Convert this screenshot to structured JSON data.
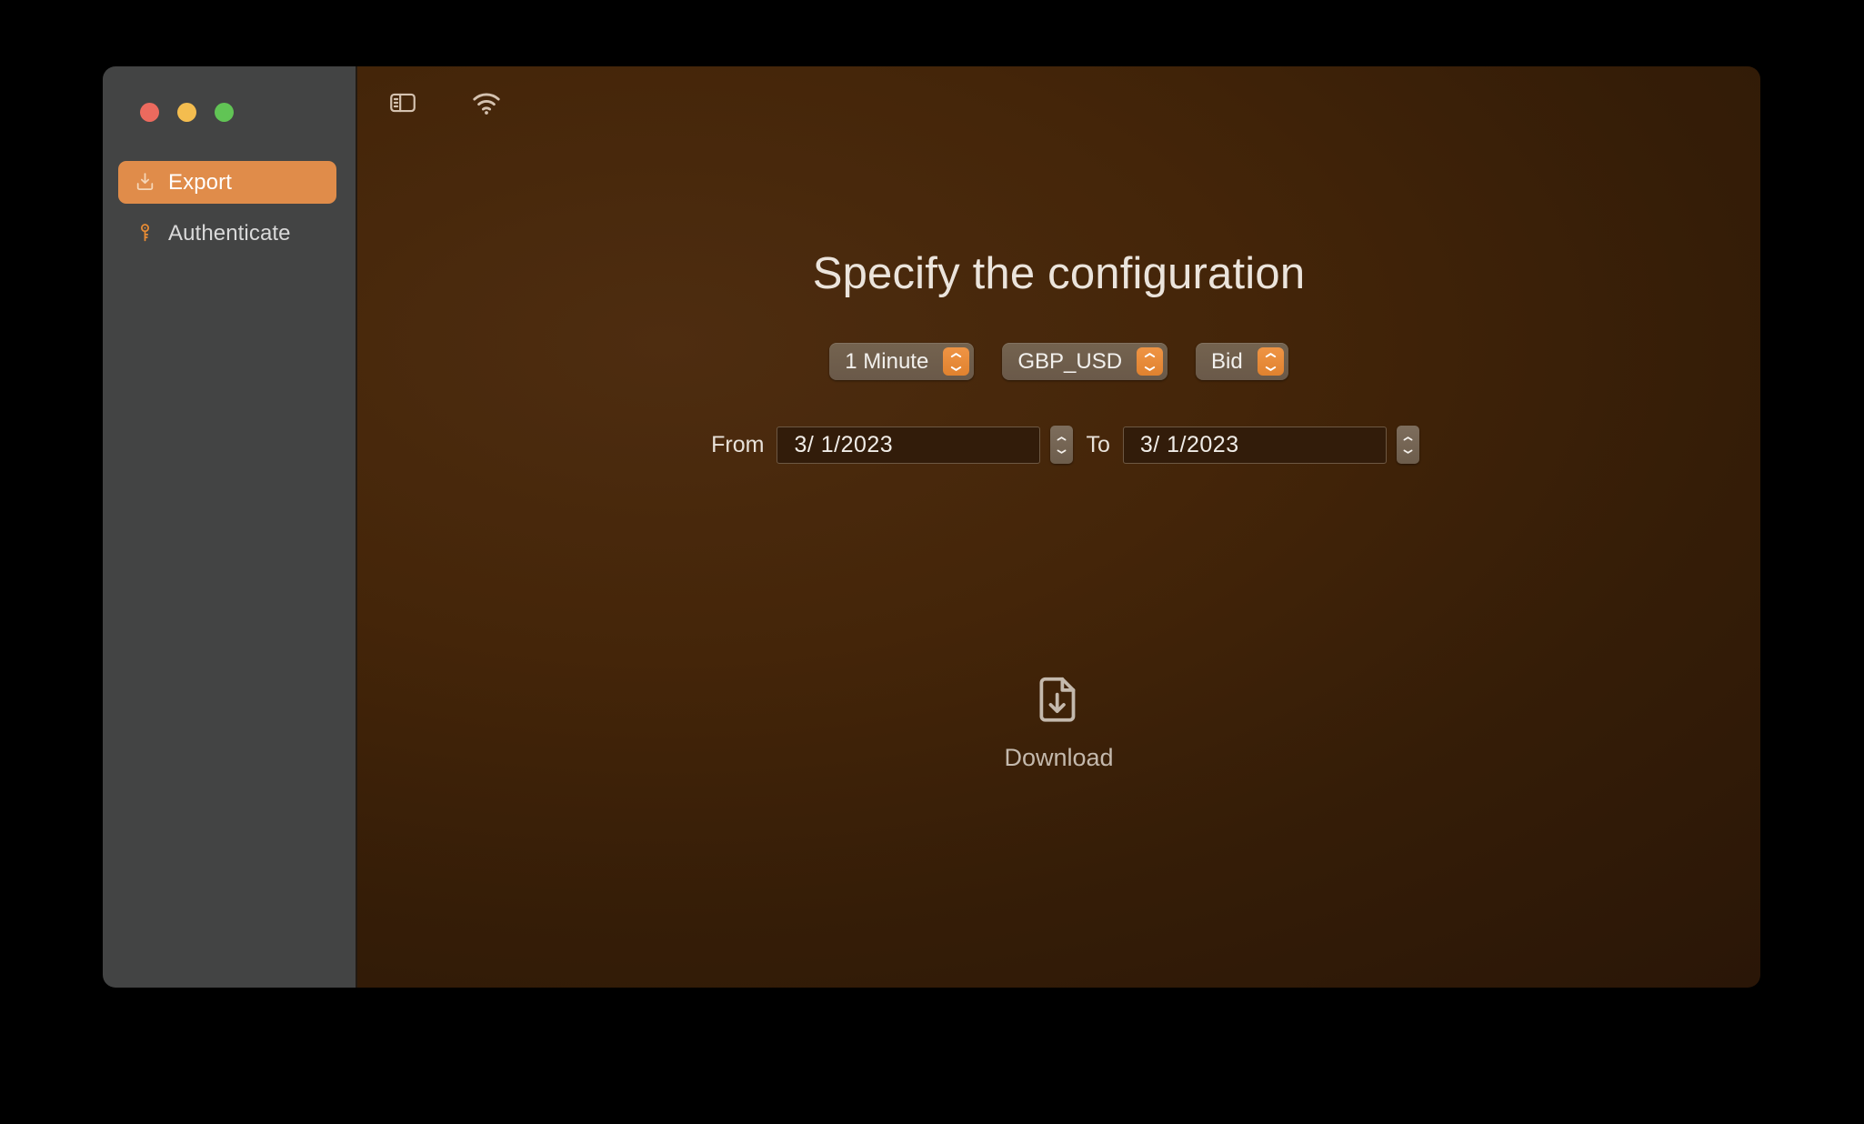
{
  "window": {
    "traffic_lights": [
      {
        "name": "close",
        "color": "#ec6a5e"
      },
      {
        "name": "minimize",
        "color": "#f4bd4f"
      },
      {
        "name": "maximize",
        "color": "#61c455"
      }
    ]
  },
  "sidebar": {
    "items": [
      {
        "label": "Export",
        "icon": "export-tray-icon",
        "selected": true
      },
      {
        "label": "Authenticate",
        "icon": "key-icon",
        "selected": false
      }
    ],
    "selected_background": "#e08c4a",
    "background": "#434444"
  },
  "toolbar": {
    "buttons": [
      {
        "name": "sidebar-toggle",
        "icon": "sidebar-toggle-icon"
      },
      {
        "name": "wifi-status",
        "icon": "wifi-icon"
      }
    ],
    "icon_color": "#d5c2b0"
  },
  "main": {
    "title": "Specify the configuration",
    "popups": [
      {
        "name": "interval",
        "value": "1 Minute"
      },
      {
        "name": "symbol",
        "value": "GBP_USD"
      },
      {
        "name": "price-type",
        "value": "Bid"
      }
    ],
    "date_range": {
      "from_label": "From",
      "from_value": "3/  1/2023",
      "to_label": "To",
      "to_value": "3/  1/2023"
    },
    "download": {
      "label": "Download",
      "icon": "document-download-icon"
    }
  },
  "colors": {
    "accent_orange": "#e08c4a",
    "stepper_orange": "#ef9444",
    "content_bg_light": "#4e2d10",
    "content_bg_dark": "#2a1607",
    "text_primary": "#ebe4dc",
    "text_secondary": "#c4b9ad"
  }
}
